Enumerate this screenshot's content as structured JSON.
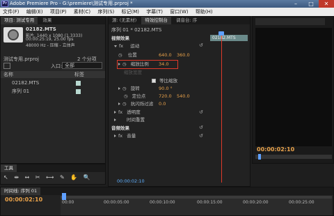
{
  "window": {
    "title": "Adobe Premiere Pro - G:\\premiere\\测试专用.prproj *",
    "min": "–",
    "max": "□",
    "close": "✕"
  },
  "menu": [
    "文件(F)",
    "编辑(E)",
    "项目(P)",
    "素材(C)",
    "序列(S)",
    "标记(M)",
    "字幕(T)",
    "窗口(W)",
    "帮助(H)"
  ],
  "project": {
    "tabs": [
      "项目: 测试专用",
      "效果"
    ],
    "clip_name": "02182.MTS",
    "clip_info1": "影片, 1440 x 1080 (1.3333)",
    "clip_info2": "00:00:25:19, 25.00 fps",
    "clip_info3": "48000 Hz - 压缩 - 立体声",
    "project_file": "测试专用.prproj",
    "item_count": "2 个分项",
    "search_label": "入口:",
    "search_value": "全部",
    "col_name": "名称",
    "col_label": "标签",
    "items": [
      {
        "name": "02182.MTS",
        "color": "#b8d8d0"
      },
      {
        "name": "序列 01",
        "color": "#b8d8d0"
      }
    ]
  },
  "tools_label": "工具",
  "source_tabs": [
    "源: (无素材)",
    "特效控制台",
    "调音台: 序"
  ],
  "effects": {
    "header_seq": "序列 01 * 02182.MTS",
    "timecode_top": "02182.MTS",
    "video_effects": "视频效果",
    "motion": "运动",
    "position": "位置",
    "position_x": "640.0",
    "position_y": "360.0",
    "scale": "缩放比例",
    "scale_value": "34.0",
    "scale_width": "缩放宽度",
    "uniform_scale": "等比缩放",
    "rotation": "旋转",
    "rotation_value": "90.0 °",
    "anchor": "定位点",
    "anchor_x": "720.0",
    "anchor_y": "540.0",
    "antiflicker": "抗闪烁过滤",
    "antiflicker_value": "0.0",
    "opacity": "透明度",
    "time_remap": "时间重置",
    "audio_effects": "音频效果",
    "volume": "音量",
    "timecode_bottom": "00:00:02:10"
  },
  "program": {
    "timecode": "00:00:02:10"
  },
  "timeline": {
    "tab": "时间线: 序列 01",
    "timecode": "00:00:02:10",
    "ruler": [
      "00:00",
      "00:00:05:00",
      "00:00:10:00",
      "00:00:15:00",
      "00:00:20:00",
      "00:00:25:00"
    ]
  }
}
